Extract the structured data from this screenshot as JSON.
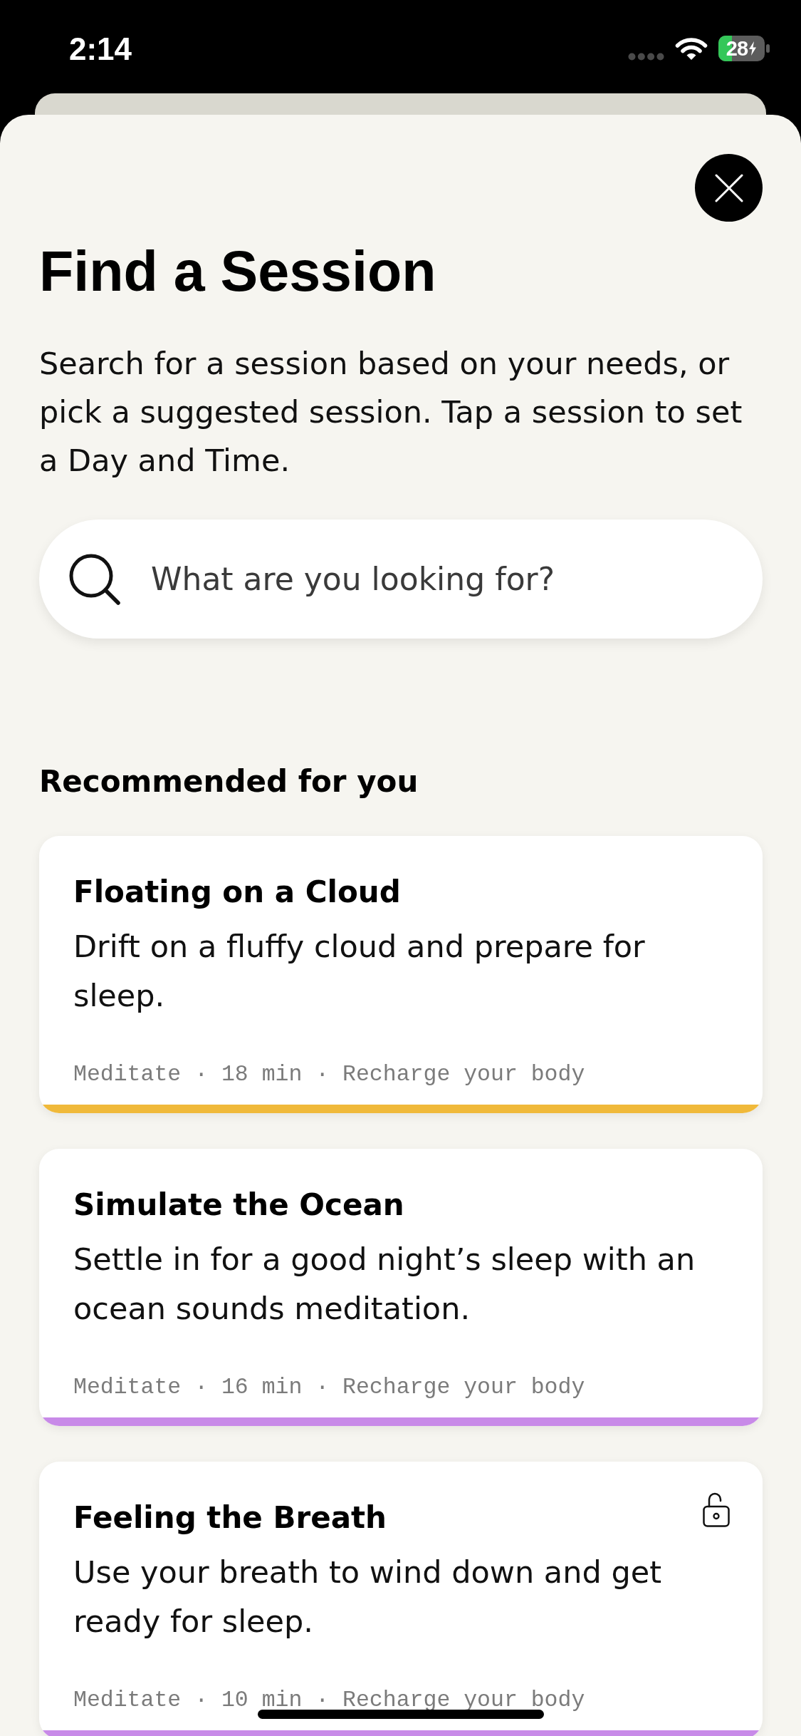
{
  "status_bar": {
    "time": "2:14",
    "battery": "28"
  },
  "title": "Find a Session",
  "description": "Search for a session based on your needs, or pick a suggested session. Tap a session to set a Day and Time.",
  "search": {
    "placeholder": "What are you looking for?"
  },
  "section_title": "Recommended for you",
  "sessions": [
    {
      "title": "Floating on a Cloud",
      "description": "Drift on a fluffy cloud and prepare for sleep.",
      "meta": "Meditate · 18 min · Recharge your body",
      "color": "#f0b93a",
      "unlocked": false
    },
    {
      "title": "Simulate the Ocean",
      "description": "Settle in for a good night’s sleep with an ocean sounds meditation.",
      "meta": "Meditate · 16 min · Recharge your body",
      "color": "#c88ae8",
      "unlocked": false
    },
    {
      "title": "Feeling the Breath",
      "description": "Use your breath to wind down and get ready for sleep.",
      "meta": "Meditate · 10 min · Recharge your body",
      "color": "#c88ae8",
      "unlocked": true
    }
  ]
}
